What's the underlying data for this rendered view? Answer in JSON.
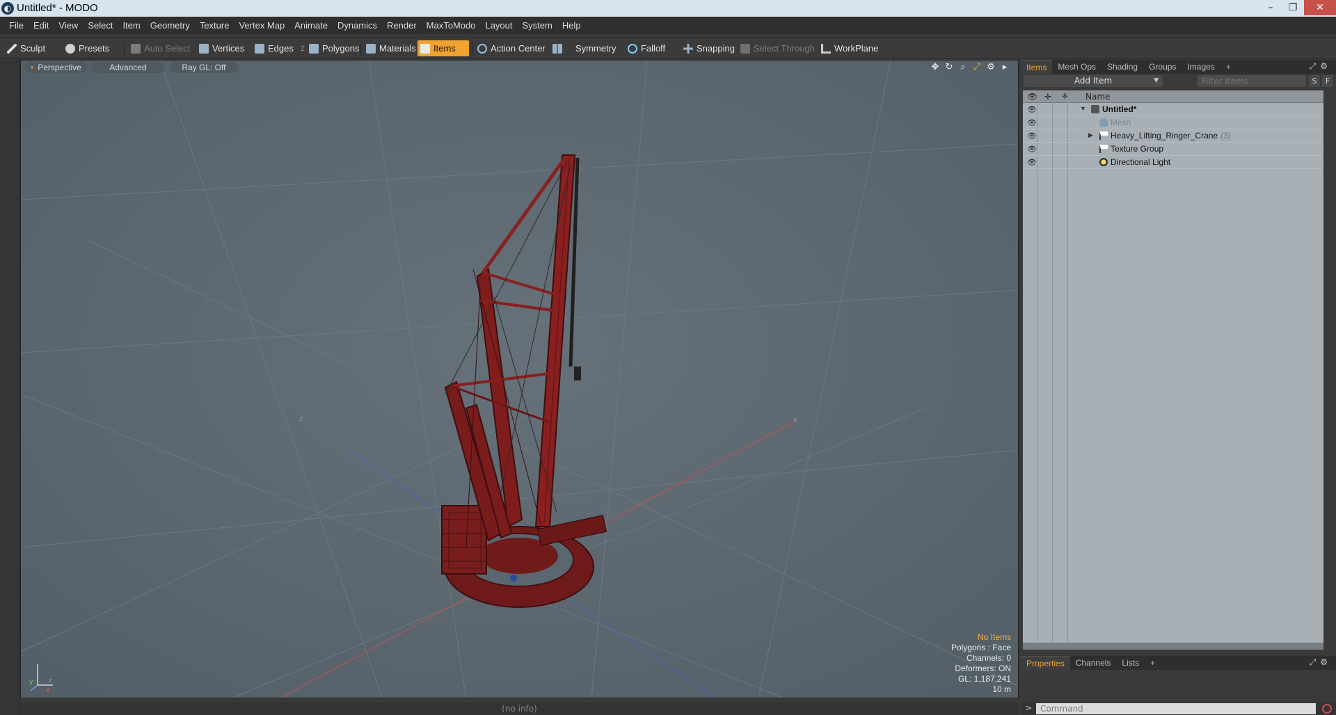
{
  "window": {
    "app_glyph": "◐",
    "title": "Untitled* - MODO",
    "min": "–",
    "max": "❐",
    "close": "✕"
  },
  "menu": [
    "File",
    "Edit",
    "View",
    "Select",
    "Item",
    "Geometry",
    "Texture",
    "Vertex Map",
    "Animate",
    "Dynamics",
    "Render",
    "MaxToModo",
    "Layout",
    "System",
    "Help"
  ],
  "toolbar": {
    "sculpt": "Sculpt",
    "presets": "Presets",
    "auto_select": "Auto Select",
    "vertices": "Vertices",
    "edges": "Edges",
    "edges_count": "2",
    "polygons": "Polygons",
    "materials": "Materials",
    "items": "Items",
    "action_center": "Action Center",
    "symmetry": "Symmetry",
    "falloff": "Falloff",
    "snapping": "Snapping",
    "select_through": "Select Through",
    "workplane": "WorkPlane"
  },
  "viewport": {
    "view": "Perspective",
    "mode": "Advanced",
    "raygl": "Ray GL: Off",
    "icons": [
      "move-view-icon",
      "rotate-view-icon",
      "zoom-view-icon",
      "maximize-icon",
      "gear-icon",
      "expand-icon"
    ],
    "axis_labels": {
      "x": "x",
      "y": "y",
      "z": "z"
    },
    "stats": {
      "no_items": "No Items",
      "polygons": "Polygons : Face",
      "channels": "Channels: 0",
      "deformers": "Deformers: ON",
      "gl": "GL: 1,187,241",
      "scale": "10 m"
    },
    "status": "(no info)"
  },
  "right_panel": {
    "tabs": [
      "Items",
      "Mesh Ops",
      "Shading",
      "Groups",
      "Images"
    ],
    "active_tab": "Items",
    "add_item": "Add Item",
    "filter_placeholder": "Filter Items",
    "s_btn": "S",
    "f_btn": "F",
    "tree_header": "Name",
    "tree": [
      {
        "name": "Untitled*",
        "icon": "scene-icon",
        "arrow": "▼",
        "style": "bold"
      },
      {
        "name": "Mesh",
        "icon": "mesh-icon",
        "arrow": "",
        "style": "dim"
      },
      {
        "name": "Heavy_Lifting_Ringer_Crane",
        "count": "(3)",
        "icon": "group-locator-icon",
        "arrow": "▶",
        "style": "normal"
      },
      {
        "name": "Texture Group",
        "icon": "group-locator-icon",
        "arrow": "",
        "style": "normal"
      },
      {
        "name": "Directional Light",
        "icon": "directional-light-icon",
        "arrow": "",
        "style": "normal"
      }
    ],
    "bottom_tabs": [
      "Properties",
      "Channels",
      "Lists"
    ],
    "bottom_active_tab": "Properties",
    "command_placeholder": "Command",
    "command_prompt": ">"
  },
  "colors": {
    "accent": "#f0a330",
    "viewport_bg": "#5b6770",
    "crane_red": "#8a1f1f",
    "tree_bg": "#a8b0b6"
  }
}
